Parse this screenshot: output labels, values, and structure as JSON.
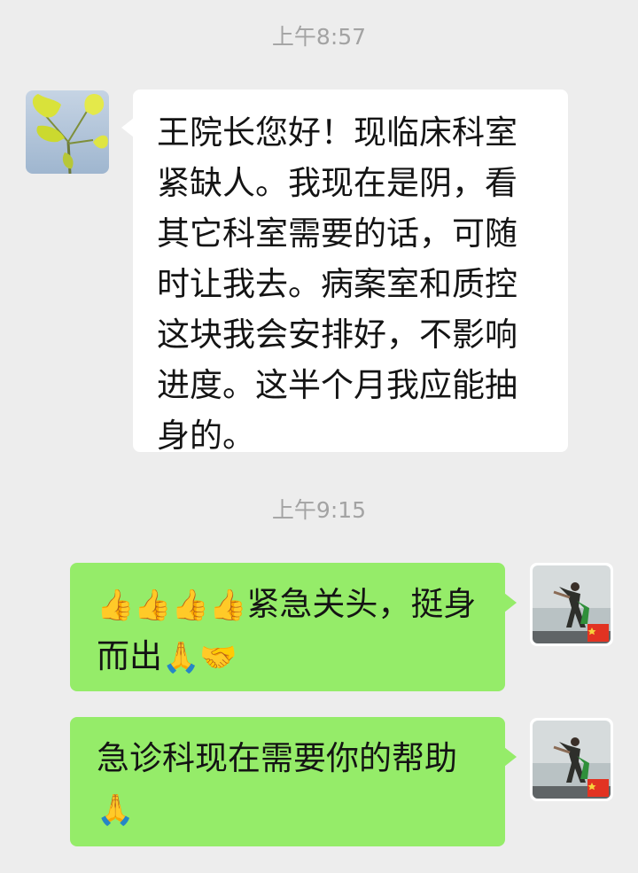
{
  "timestamps": [
    "上午8:57",
    "上午9:15"
  ],
  "messages": [
    {
      "side": "left",
      "avatar": "ginkgo-leaf-avatar",
      "text": "王院长您好！现临床科室紧缺人。我现在是阴，看其它科室需要的话，可随时让我去。病案室和质控这块我会安排好，不影响进度。这半个月我应能抽身的。"
    },
    {
      "side": "right",
      "avatar": "seaside-pose-avatar",
      "emoji_prefix": "👍👍👍👍",
      "text": "紧急关头，挺身而出",
      "emoji_suffix": "🙏🤝"
    },
    {
      "side": "right",
      "avatar": "seaside-pose-avatar",
      "text": "急诊科现在需要你的帮助",
      "emoji_suffix": "🙏"
    }
  ],
  "colors": {
    "background": "#ededed",
    "incoming_bubble": "#ffffff",
    "outgoing_bubble": "#95ec69",
    "timestamp": "#a3a3a3"
  }
}
